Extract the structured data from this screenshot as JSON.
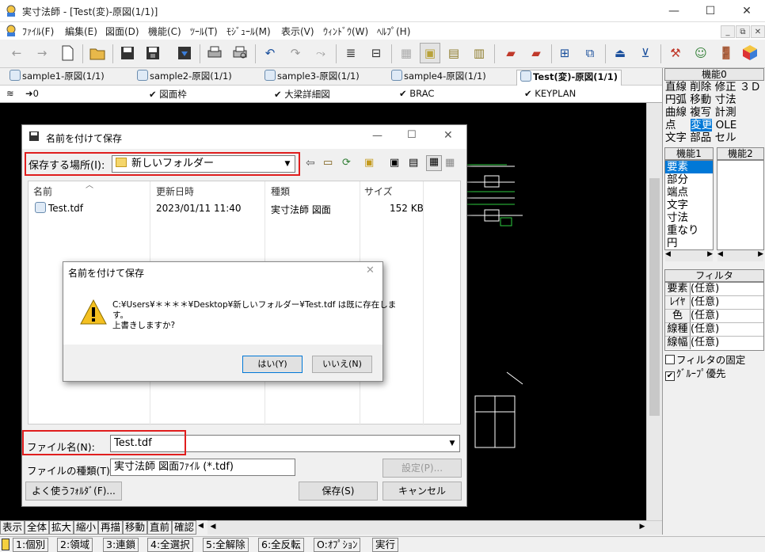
{
  "window": {
    "title": "実寸法師 - [Test(変)-原図(1/1)]",
    "controls": [
      "—",
      "☐",
      "✕"
    ],
    "mdi_controls": [
      "_",
      "⧉",
      "✕"
    ]
  },
  "menu": [
    "ﾌｧｲﾙ(F)",
    "編集(E)",
    "図面(D)",
    "機能(C)",
    "ﾂｰﾙ(T)",
    "ﾓｼﾞｭｰﾙ(M)",
    "表示(V)",
    "ｳｨﾝﾄﾞｳ(W)",
    "ﾍﾙﾌﾟ(H)"
  ],
  "tabs": [
    "sample1-原図(1/1)",
    "sample2-原図(1/1)",
    "sample3-原図(1/1)",
    "sample4-原図(1/1)",
    "Test(変)-原図(1/1)"
  ],
  "layerbar": {
    "layer": "0",
    "items": [
      "図面枠",
      "大梁詳細図",
      "BRAC",
      "KEYPLAN"
    ]
  },
  "panel": {
    "func0_title": "機能0",
    "func0_rows": [
      [
        "直線",
        "削除",
        "修正",
        "３Ｄ"
      ],
      [
        "円弧",
        "移動",
        "寸法"
      ],
      [
        "曲線",
        "複写",
        "計測"
      ],
      [
        "点",
        "変更",
        "OLE"
      ],
      [
        "文字",
        "部品",
        "セル"
      ]
    ],
    "func0_selected": "変更",
    "func1_title": "機能1",
    "func2_title": "機能2",
    "func1_items": [
      "要素",
      "部分",
      "端点",
      "文字",
      "寸法",
      "重なり",
      "円"
    ],
    "func1_selected": "要素",
    "filter_title": "フィルタ",
    "filters": [
      {
        "key": "要素",
        "val": "(任意)"
      },
      {
        "key": "ﾚｲﾔ",
        "val": "(任意)"
      },
      {
        "key": "色",
        "val": "(任意)"
      },
      {
        "key": "線種",
        "val": "(任意)"
      },
      {
        "key": "線幅",
        "val": "(任意)"
      }
    ],
    "fix_filter": "フィルタの固定",
    "group_priority": "ｸﾞﾙｰﾌﾟ優先"
  },
  "cmdbar": [
    "表示",
    "全体",
    "拡大",
    "縮小",
    "再描",
    "移動",
    "直前",
    "確認"
  ],
  "statusbar": [
    "1:個別",
    "2:領域",
    "3:連鎖",
    "4:全選択",
    "5:全解除",
    "6:全反転",
    "O:ｵﾌﾟｼｮﾝ",
    "実行"
  ],
  "save_dialog": {
    "title": "名前を付けて保存",
    "location_label": "保存する場所(I):",
    "location_value": "新しいフォルダー",
    "columns": [
      "名前",
      "更新日時",
      "種類",
      "サイズ"
    ],
    "files": [
      {
        "name": "Test.tdf",
        "date": "2023/01/11 11:40",
        "type": "実寸法師 図面",
        "size": "152 KB"
      }
    ],
    "filename_label": "ファイル名(N):",
    "filename_value": "Test.tdf",
    "filetype_label": "ファイルの種類(T):",
    "filetype_value": "実寸法師 図面ﾌｧｲﾙ (*.tdf)",
    "settings_button": "設定(P)...",
    "favorites_button": "よく使うﾌｫﾙﾀﾞ(F)...",
    "save_button": "保存(S)",
    "cancel_button": "キャンセル"
  },
  "confirm_dialog": {
    "title": "名前を付けて保存",
    "message_line1": "C:¥Users¥＊＊＊＊¥Desktop¥新しいフォルダー¥Test.tdf は既に存在しま",
    "message_line2": "す。",
    "message_line3": "上書きしますか?",
    "yes_button": "はい(Y)",
    "no_button": "いいえ(N)"
  },
  "colors": {
    "highlight": "#e01e1e",
    "selection": "#0078d7",
    "canvas": "#000000"
  }
}
